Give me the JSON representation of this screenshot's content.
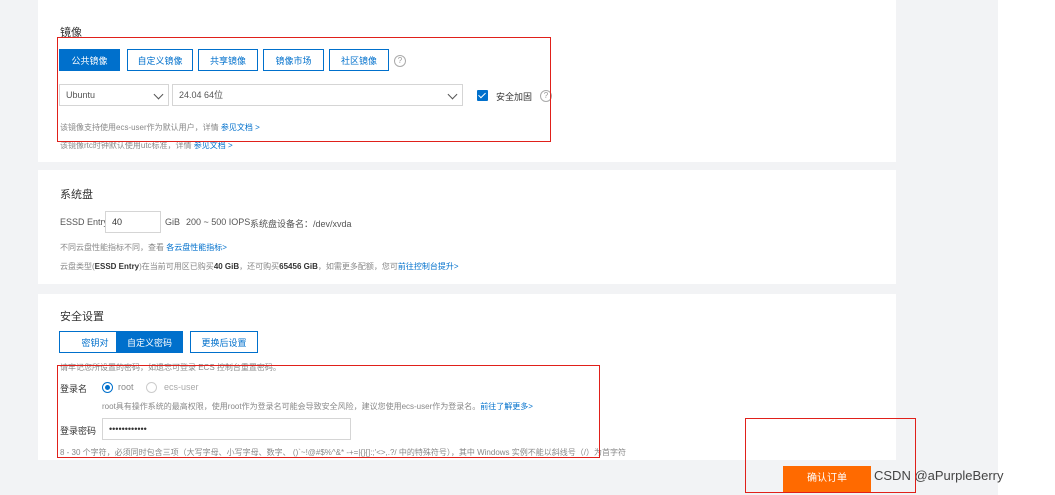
{
  "image_section": {
    "title": "镜像",
    "tabs": [
      {
        "label": "公共镜像",
        "active": true
      },
      {
        "label": "自定义镜像",
        "active": false
      },
      {
        "label": "共享镜像",
        "active": false
      },
      {
        "label": "镜像市场",
        "active": false
      },
      {
        "label": "社区镜像",
        "active": false
      }
    ],
    "os_select": "Ubuntu",
    "version_select": "24.04 64位",
    "security_label": "安全加固",
    "security_checked": true,
    "note1_text": "该镜像支持使用ecs-user作为默认用户，详情",
    "note1_link": "参见文档 >",
    "note2_text": "该镜像rtc时钟默认使用utc标准，详情",
    "note2_link": "参见文档 >"
  },
  "disk_section": {
    "title": "系统盘",
    "disk_type": "ESSD Entry",
    "size_value": "40",
    "unit": "GiB",
    "iops": "200 ~ 500 IOPS",
    "device_label": "系统盘设备名：/dev/xvda",
    "note1_text": "不同云盘性能指标不同，查看",
    "note1_link": "各云盘性能指标>",
    "note2_part1": "云盘类型(",
    "note2_bold1": "ESSD Entry",
    "note2_part2": ")在当前可用区已购买",
    "note2_bold2": "40 GiB",
    "note2_part3": "，还可购买",
    "note2_bold3": "65456 GiB",
    "note2_part4": "，如需更多配额，您可",
    "note2_link": "前往控制台提升>"
  },
  "security_section": {
    "title": "安全设置",
    "tabs": [
      {
        "label": "密钥对",
        "active": false
      },
      {
        "label": "自定义密码",
        "active": true
      },
      {
        "label": "更换后设置",
        "active": false
      }
    ],
    "warning": "请牢记您所设置的密码，如遗忘可登录 ECS 控制台重置密码。",
    "login_label": "登录名",
    "option_root": "root",
    "option_ecs": "ecs-user",
    "root_note": "root具有操作系统的最高权限，使用root作为登录名可能会导致安全风险，建议您使用ecs-user作为登录名。",
    "root_note_link": "前往了解更多>",
    "password_label": "登录密码",
    "password_value": "••••••••••••",
    "password_rule": "8 - 30 个字符，必须同时包含三项（大写字母、小写字母、数字、 ()`~!@#$%^&* -+=|{}[]:;'<>,.?/ 中的特殊符号），其中 Windows 实例不能以斜线号（/）为首字符"
  },
  "footer": {
    "order_button": "确认订单",
    "watermark": "CSDN @aPurpleBerry"
  },
  "colors": {
    "primary": "#0070cc",
    "order": "#ff6a00",
    "annotation": "#e0201a"
  }
}
